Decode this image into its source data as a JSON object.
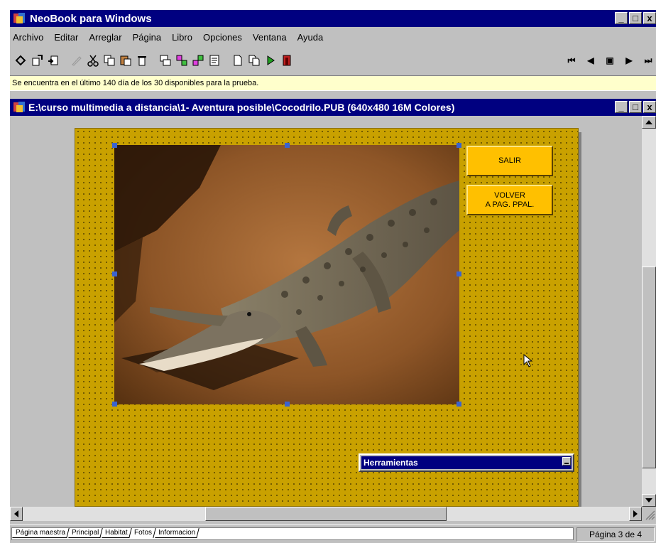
{
  "app": {
    "title": "NeoBook para Windows",
    "icon": "neobook-app-icon"
  },
  "window_buttons": {
    "minimize": "_",
    "maximize": "□",
    "close": "x"
  },
  "menu": {
    "items": [
      {
        "label": "Archivo"
      },
      {
        "label": "Editar"
      },
      {
        "label": "Arreglar"
      },
      {
        "label": "Página"
      },
      {
        "label": "Libro"
      },
      {
        "label": "Opciones"
      },
      {
        "label": "Ventana"
      },
      {
        "label": "Ayuda"
      }
    ]
  },
  "toolbar": {
    "icons": [
      "pointer-tool-icon",
      "import-icon",
      "export-icon",
      "edit-icon",
      "cut-icon",
      "copy-icon",
      "paste-icon",
      "delete-icon",
      "object-icon",
      "group-icon",
      "ungroup-icon",
      "properties-icon",
      "new-page-icon",
      "copy-page-icon",
      "run-icon",
      "exit-icon"
    ],
    "nav": [
      "first-page-icon",
      "prev-page-icon",
      "goto-page-icon",
      "next-page-icon",
      "last-page-icon"
    ],
    "nav_glyphs": [
      "⏮",
      "◀",
      "▣",
      "▶",
      "⏭"
    ]
  },
  "info": {
    "message": "Se encuentra en el último  140 día de los 30 disponibles para la prueba."
  },
  "document": {
    "title": "E:\\curso multimedia a distancia\\1- Aventura posible\\Cocodrilo.PUB (640x480 16M Colores)"
  },
  "page": {
    "background": "#c9a100",
    "button_color": "#ffc000",
    "buttons": [
      {
        "label": "SALIR"
      },
      {
        "label": "VOLVER\nA PAG. PPAL."
      }
    ]
  },
  "palette": {
    "title": "Herramientas"
  },
  "tabs": [
    {
      "label": "Página maestra"
    },
    {
      "label": "Principal"
    },
    {
      "label": "Habitat"
    },
    {
      "label": "Fotos",
      "active": true
    },
    {
      "label": "Informacion"
    }
  ],
  "status": {
    "page": "Página 3 de 4"
  },
  "colors": {
    "titlebar": "#000080",
    "face": "#c0c0c0",
    "infobar": "#ffffcc"
  }
}
